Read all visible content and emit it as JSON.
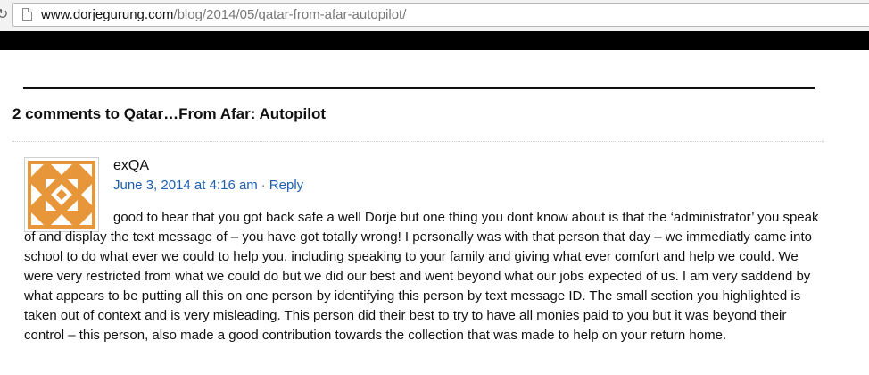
{
  "browser": {
    "url_host": "www.dorjegurung.com",
    "url_path": "/blog/2014/05/qatar-from-afar-autopilot/"
  },
  "comments": {
    "heading": "2 comments to Qatar…From Afar: Autopilot",
    "items": [
      {
        "author": "exQA",
        "date": "June 3, 2014 at 4:16 am",
        "separator": "·",
        "reply_label": "Reply",
        "text": "good to hear that you got back safe a well Dorje but one thing you dont know about is that the ‘administrator’ you speak of and display the text message of – you have got totally wrong! I personally was with that person that day – we immediatly came into school to do what ever we could to help you, including speaking to your family and giving what ever comfort and help we could. We were very restricted from what we could do but we did our best and went beyond what our jobs expected of us. I am very saddend by what appears to be putting all this on one person by identifying this person by text message ID. The small section you highlighted is taken out of context and is very misleading. This person did their best to try to have all monies paid to you but it was beyond their control – this person, also made a good contribution towards the collection that was made to help on your return home."
      }
    ]
  },
  "colors": {
    "link": "#1f5fae",
    "avatar": "#e8963a"
  }
}
